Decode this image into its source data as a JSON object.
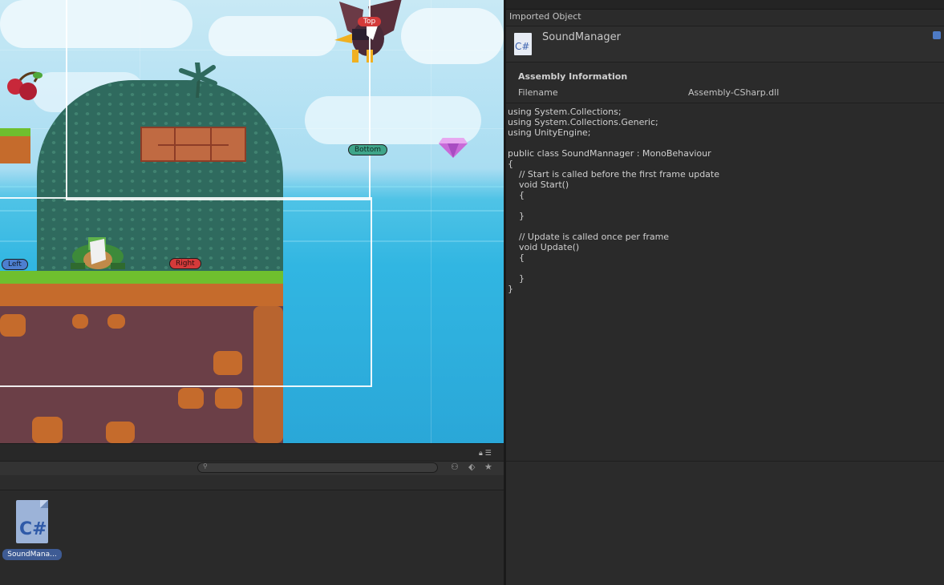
{
  "scene": {
    "tags": {
      "top": "Top",
      "bottom": "Bottom",
      "left": "Left",
      "right": "Right"
    },
    "colors": {
      "tag_red": "#d43a3a",
      "tag_green": "#3fa58a",
      "tag_blue": "#4d7fd0"
    }
  },
  "project": {
    "asset": {
      "icon_text": "C#",
      "label": "SoundMana..."
    },
    "toolbar_icons": [
      "search-icon",
      "filter-by-type-icon",
      "filter-by-label-icon",
      "favorite-star-icon",
      "lock-icon",
      "menu-icon"
    ]
  },
  "inspector": {
    "header": "Imported Object",
    "object_name": "SoundManager",
    "file_icon_text": "C#",
    "assembly": {
      "title": "Assembly Information",
      "filename_label": "Filename",
      "filename_value": "Assembly-CSharp.dll"
    },
    "code": "using System.Collections;\nusing System.Collections.Generic;\nusing UnityEngine;\n\npublic class SoundMannager : MonoBehaviour\n{\n    // Start is called before the first frame update\n    void Start()\n    {\n        \n    }\n\n    // Update is called once per frame\n    void Update()\n    {\n        \n    }\n}"
  }
}
